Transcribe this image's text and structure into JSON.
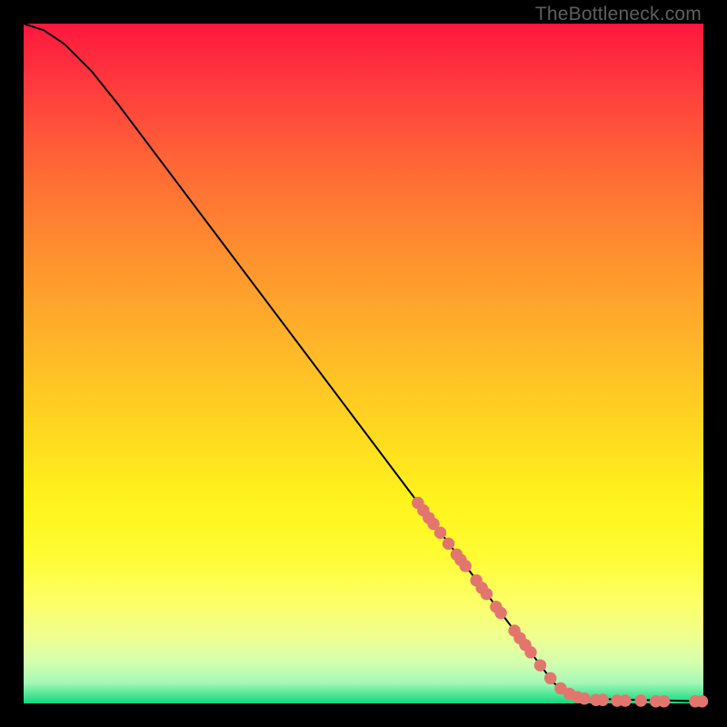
{
  "watermark": "TheBottleneck.com",
  "chart_data": {
    "type": "line",
    "title": "",
    "xlabel": "",
    "ylabel": "",
    "xlim": [
      0,
      100
    ],
    "ylim": [
      0,
      100
    ],
    "curve": [
      {
        "x": 0.0,
        "y": 100.0
      },
      {
        "x": 3.0,
        "y": 99.0
      },
      {
        "x": 6.0,
        "y": 97.0
      },
      {
        "x": 10.0,
        "y": 93.0
      },
      {
        "x": 14.0,
        "y": 88.0
      },
      {
        "x": 78.0,
        "y": 3.0
      },
      {
        "x": 80.0,
        "y": 1.5
      },
      {
        "x": 82.0,
        "y": 0.7
      },
      {
        "x": 100.0,
        "y": 0.3
      }
    ],
    "points": [
      {
        "x": 58.0,
        "y": 29.5
      },
      {
        "x": 58.8,
        "y": 28.4
      },
      {
        "x": 59.6,
        "y": 27.3
      },
      {
        "x": 60.3,
        "y": 26.4
      },
      {
        "x": 61.3,
        "y": 25.1
      },
      {
        "x": 62.5,
        "y": 23.5
      },
      {
        "x": 63.7,
        "y": 21.9
      },
      {
        "x": 64.3,
        "y": 21.1
      },
      {
        "x": 65.0,
        "y": 20.2
      },
      {
        "x": 66.6,
        "y": 18.1
      },
      {
        "x": 67.4,
        "y": 17.0
      },
      {
        "x": 68.1,
        "y": 16.1
      },
      {
        "x": 69.5,
        "y": 14.2
      },
      {
        "x": 70.2,
        "y": 13.3
      },
      {
        "x": 72.2,
        "y": 10.7
      },
      {
        "x": 73.0,
        "y": 9.6
      },
      {
        "x": 73.8,
        "y": 8.6
      },
      {
        "x": 74.6,
        "y": 7.5
      },
      {
        "x": 76.0,
        "y": 5.6
      },
      {
        "x": 77.5,
        "y": 3.7
      },
      {
        "x": 79.0,
        "y": 2.2
      },
      {
        "x": 80.3,
        "y": 1.4
      },
      {
        "x": 81.5,
        "y": 0.9
      },
      {
        "x": 82.5,
        "y": 0.7
      },
      {
        "x": 84.2,
        "y": 0.5
      },
      {
        "x": 85.2,
        "y": 0.5
      },
      {
        "x": 87.3,
        "y": 0.4
      },
      {
        "x": 88.5,
        "y": 0.4
      },
      {
        "x": 90.8,
        "y": 0.4
      },
      {
        "x": 93.0,
        "y": 0.3
      },
      {
        "x": 94.2,
        "y": 0.3
      },
      {
        "x": 98.8,
        "y": 0.3
      },
      {
        "x": 99.8,
        "y": 0.3
      }
    ],
    "point_radius_data_units": 0.9
  }
}
